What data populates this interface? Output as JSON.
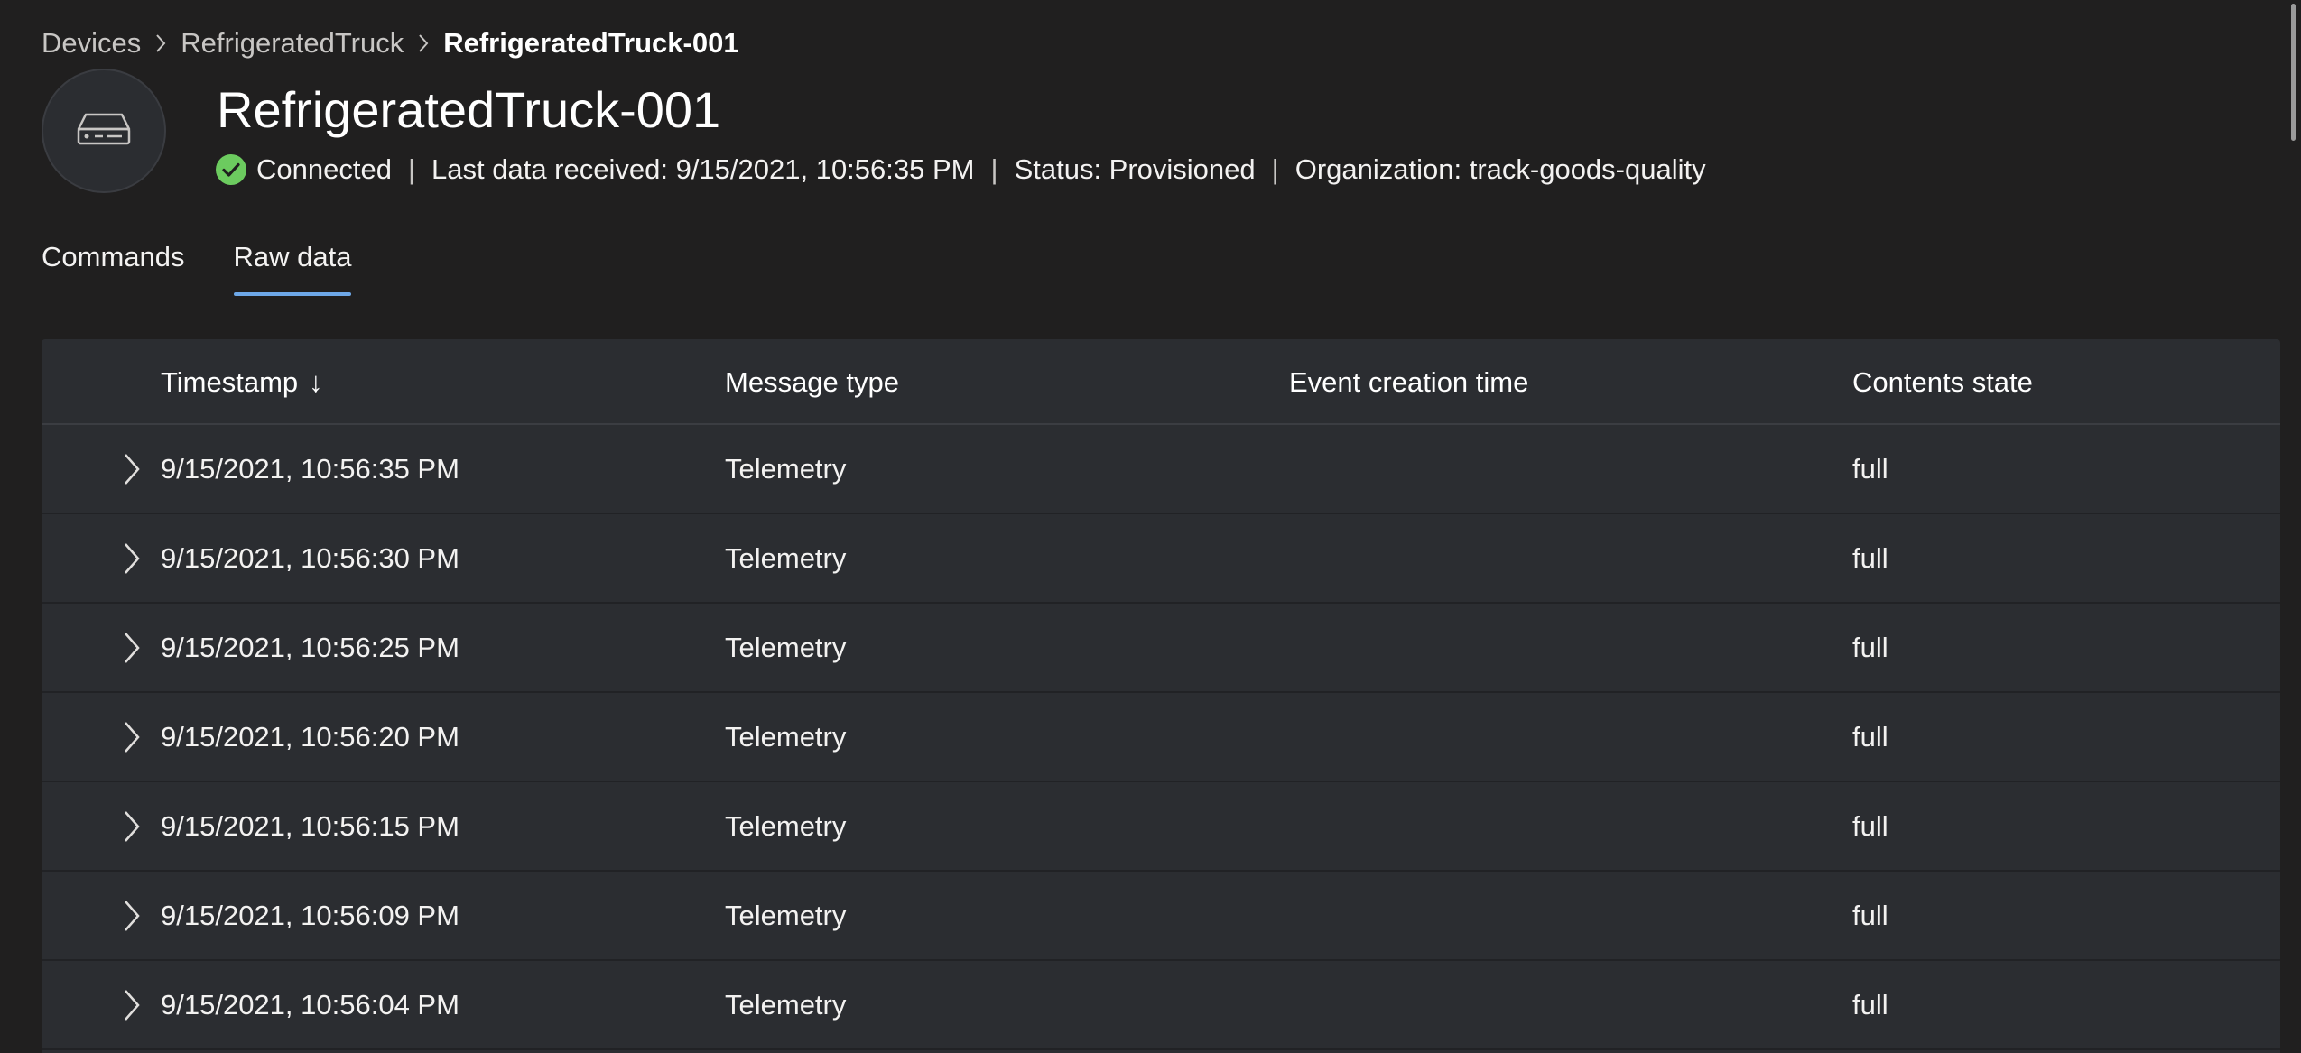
{
  "breadcrumb": {
    "items": [
      "Devices",
      "RefrigeratedTruck",
      "RefrigeratedTruck-001"
    ]
  },
  "device": {
    "icon": "device-icon",
    "name": "RefrigeratedTruck-001",
    "connection_status": "Connected",
    "last_data": "Last data received: 9/15/2021, 10:56:35 PM",
    "status": "Status: Provisioned",
    "organization": "Organization: track-goods-quality",
    "connected_color": "#6ccb5f",
    "separator": "|"
  },
  "tabs": [
    {
      "label": "Commands",
      "active": false
    },
    {
      "label": "Raw data",
      "active": true
    }
  ],
  "accent_color": "#6ea8e8",
  "table": {
    "columns": [
      "Timestamp",
      "Message type",
      "Event creation time",
      "Contents state"
    ],
    "sort_indicator": "↓",
    "rows": [
      {
        "timestamp": "9/15/2021, 10:56:35 PM",
        "message_type": "Telemetry",
        "event_creation_time": "",
        "contents_state": "full"
      },
      {
        "timestamp": "9/15/2021, 10:56:30 PM",
        "message_type": "Telemetry",
        "event_creation_time": "",
        "contents_state": "full"
      },
      {
        "timestamp": "9/15/2021, 10:56:25 PM",
        "message_type": "Telemetry",
        "event_creation_time": "",
        "contents_state": "full"
      },
      {
        "timestamp": "9/15/2021, 10:56:20 PM",
        "message_type": "Telemetry",
        "event_creation_time": "",
        "contents_state": "full"
      },
      {
        "timestamp": "9/15/2021, 10:56:15 PM",
        "message_type": "Telemetry",
        "event_creation_time": "",
        "contents_state": "full"
      },
      {
        "timestamp": "9/15/2021, 10:56:09 PM",
        "message_type": "Telemetry",
        "event_creation_time": "",
        "contents_state": "full"
      },
      {
        "timestamp": "9/15/2021, 10:56:04 PM",
        "message_type": "Telemetry",
        "event_creation_time": "",
        "contents_state": "full"
      }
    ]
  }
}
